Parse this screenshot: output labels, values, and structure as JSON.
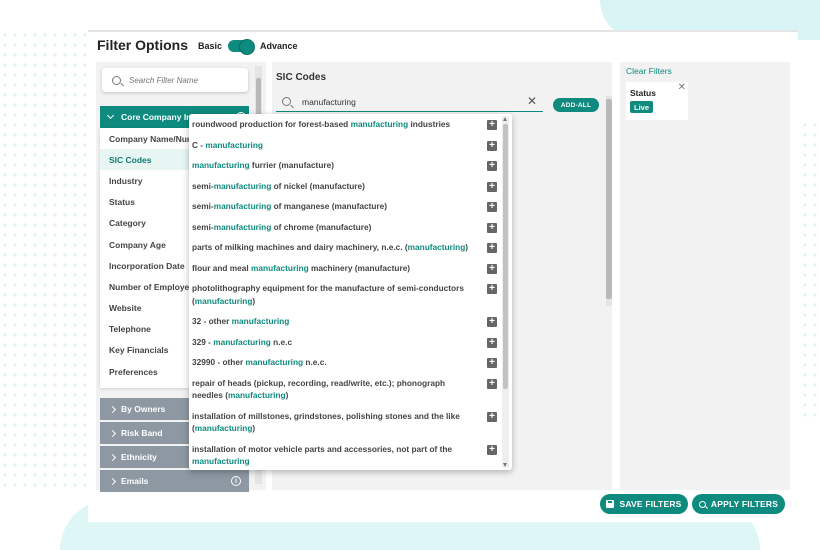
{
  "header": {
    "title": "Filter Options",
    "toggle_left": "Basic",
    "toggle_right": "Advance"
  },
  "left_panel": {
    "search_placeholder": "Search Filter Name",
    "core_header": "Core Company Information",
    "core_items": [
      {
        "label": "Company Name/Number"
      },
      {
        "label": "SIC Codes"
      },
      {
        "label": "Industry"
      },
      {
        "label": "Status"
      },
      {
        "label": "Category"
      },
      {
        "label": "Company Age"
      },
      {
        "label": "Incorporation Date"
      },
      {
        "label": "Number of Employees"
      },
      {
        "label": "Website"
      },
      {
        "label": "Telephone"
      },
      {
        "label": "Key Financials"
      },
      {
        "label": "Preferences"
      }
    ],
    "active_item": "SIC Codes",
    "groups": [
      {
        "label": "By Owners"
      },
      {
        "label": "Risk Band"
      },
      {
        "label": "Ethnicity"
      },
      {
        "label": "Emails"
      }
    ]
  },
  "middle_panel": {
    "title": "SIC Codes",
    "search_value": "manufacturing",
    "add_all_label": "ADD-ALL",
    "results": [
      {
        "pre": "roundwood production for forest-based ",
        "hl": "manufacturing",
        "post": " industries"
      },
      {
        "pre": "C - ",
        "hl": "manufacturing",
        "post": ""
      },
      {
        "pre": "",
        "hl": "manufacturing",
        "post": " furrier (manufacture)"
      },
      {
        "pre": "semi-",
        "hl": "manufacturing",
        "post": " of nickel (manufacture)"
      },
      {
        "pre": "semi-",
        "hl": "manufacturing",
        "post": " of manganese (manufacture)"
      },
      {
        "pre": "semi-",
        "hl": "manufacturing",
        "post": " of chrome (manufacture)"
      },
      {
        "pre": "parts of milking machines and dairy machinery, n.e.c. (",
        "hl": "manufacturing",
        "post": ")"
      },
      {
        "pre": "flour and meal ",
        "hl": "manufacturing",
        "post": " machinery (manufacture)"
      },
      {
        "pre": "photolithography equipment for the manufacture of semi-conductors (",
        "hl": "manufacturing",
        "post": ")"
      },
      {
        "pre": "32 - other ",
        "hl": "manufacturing",
        "post": ""
      },
      {
        "pre": "329 - ",
        "hl": "manufacturing",
        "post": " n.e.c"
      },
      {
        "pre": "32990 - other ",
        "hl": "manufacturing",
        "post": " n.e.c."
      },
      {
        "pre": "repair of heads (pickup, recording, read/write, etc.); phonograph needles (",
        "hl": "manufacturing",
        "post": ")"
      },
      {
        "pre": "installation of millstones, grindstones, polishing stones and the like (",
        "hl": "manufacturing",
        "post": ")"
      },
      {
        "pre": "installation of motor vehicle parts and accessories, not part of the ",
        "hl": "manufacturing",
        "post": ""
      }
    ]
  },
  "right_panel": {
    "clear_filters": "Clear Filters",
    "status_label": "Status",
    "status_value": "Live"
  },
  "buttons": {
    "save": "SAVE FILTERS",
    "apply": "APPLY FILTERS"
  },
  "colors": {
    "accent": "#0e8a7e",
    "group_bg": "#8d98a3",
    "panel_bg": "#f2f2f2"
  }
}
